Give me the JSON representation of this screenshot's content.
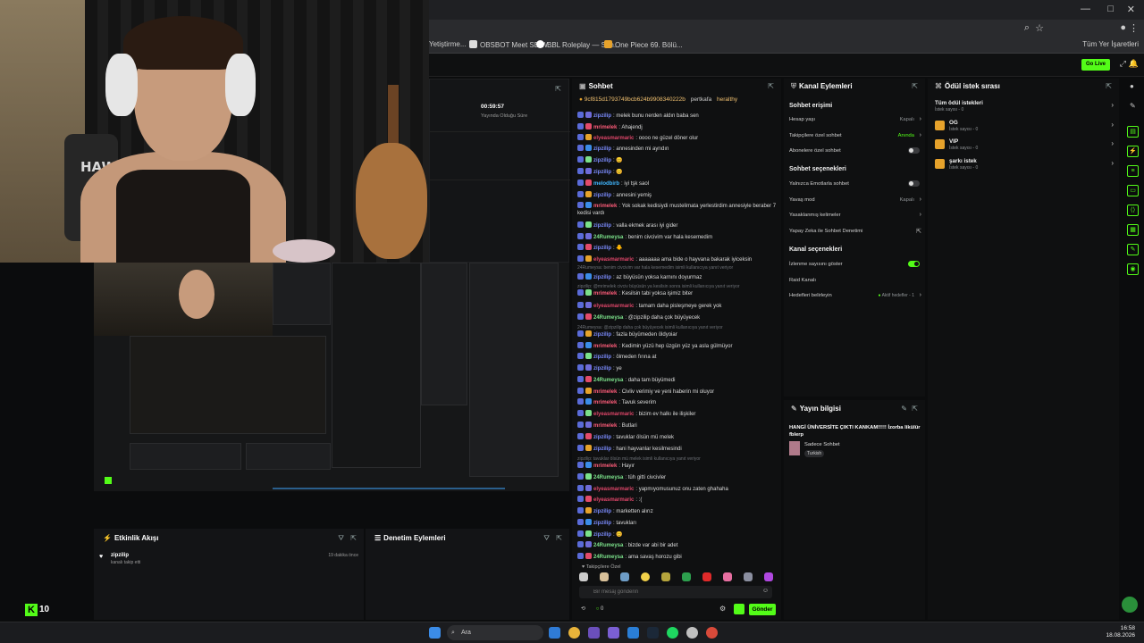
{
  "browser": {
    "bookmarks": [
      "Yetiştirme...",
      "OBSBOT Meet SE W...",
      "BBL Roleplay — San...",
      "One Piece 69. Bölü..."
    ],
    "all_bookmarks": "Tüm Yer İşaretleri"
  },
  "header": {
    "go_live": "Go Live"
  },
  "stream_stats": {
    "duration": "00:59:57",
    "duration_label": "Yayında Olduğu Süre"
  },
  "chat": {
    "title": "Sohbet",
    "pinned_user": "9cf815d1793749bcb624b9908340222b",
    "pinned_badge_users": [
      "pertkafa",
      "heralthy"
    ],
    "messages": [
      {
        "user": "zipzilip",
        "text": "melek bunu nerden aldın baba sen",
        "color": "#7c8cff"
      },
      {
        "user": "mrimelek",
        "text": "Ahajendj",
        "color": "#ff5c7a"
      },
      {
        "user": "elyeasmarmaric",
        "text": "oooo ne güzel döner olur",
        "color": "#e0466a"
      },
      {
        "user": "zipzilip",
        "text": "annesinden mi ayrıdın",
        "color": "#7c8cff"
      },
      {
        "user": "zipzilip",
        "text": "😊",
        "color": "#7c8cff"
      },
      {
        "user": "zipzilip",
        "text": "😊",
        "color": "#7c8cff"
      },
      {
        "user": "melodbirb",
        "text": "iyi tşk saol",
        "color": "#41b7ff"
      },
      {
        "user": "zipzilip",
        "text": "annesini yemiş",
        "color": "#7c8cff"
      },
      {
        "user": "mrimelek",
        "text": "Yok sokak kedisiydi mustelimata yerlestirdim annesiyle beraber 7 kedisi vardı",
        "color": "#ff5c7a"
      },
      {
        "user": "zipzilip",
        "text": "valla ekmek arası iyi gider",
        "color": "#7c8cff"
      },
      {
        "user": "24Rumeysa",
        "text": "benim civcivim var hala kesemedim",
        "color": "#7be08a"
      },
      {
        "user": "zipzilip",
        "text": "🐥",
        "color": "#7c8cff"
      },
      {
        "user": "elyeasmarmaric",
        "text": "aaaaaaa ama bide o hayvana bakarak iyiceksin",
        "color": "#e0466a"
      },
      {
        "user": "zipzilip",
        "text": "az büyüsün yoksa karnını doyurmaz",
        "color": "#7c8cff"
      },
      {
        "user": "mrimelek",
        "text": "Kesilsin tabi yoksa işimiz biter",
        "color": "#ff5c7a"
      },
      {
        "user": "elyeasmarmaric",
        "text": "tamam daha pisleşmeye gerek yok",
        "color": "#e0466a"
      },
      {
        "user": "24Rumeysa",
        "text": "@zipzilip daha çok büyüyecek",
        "color": "#7be08a"
      },
      {
        "user": "zipzilip",
        "text": "fazla büyümeden öldyoiar",
        "color": "#7c8cff"
      },
      {
        "user": "mrimelek",
        "text": "Kedimin yüzü hep üzgün yüz ya asla gülmüyor",
        "color": "#ff5c7a"
      },
      {
        "user": "zipzilip",
        "text": "ölmeden fırına at",
        "color": "#7c8cff"
      },
      {
        "user": "zipzilip",
        "text": "ye",
        "color": "#7c8cff"
      },
      {
        "user": "24Rumeysa",
        "text": "daha tam büyümedi",
        "color": "#7be08a"
      },
      {
        "user": "mrimelek",
        "text": "Civliv verimiy ve yeni haberin mi oluyor",
        "color": "#ff5c7a"
      },
      {
        "user": "mrimelek",
        "text": "Tavuk severim",
        "color": "#ff5c7a"
      },
      {
        "user": "elyeasmarmaric",
        "text": "bizim ev halkı ile ilişkiler",
        "color": "#e0466a"
      },
      {
        "user": "mrimelek",
        "text": "Butlari",
        "color": "#ff5c7a"
      },
      {
        "user": "zipzilip",
        "text": "tavuklar ölsün mü melek",
        "color": "#7c8cff"
      },
      {
        "user": "zipzilip",
        "text": "hani hayvanlar kesilmesindi",
        "color": "#7c8cff"
      },
      {
        "user": "mrimelek",
        "text": "Hayır",
        "color": "#ff5c7a"
      },
      {
        "user": "24Rumeysa",
        "text": "tüh gitti civcivler",
        "color": "#7be08a"
      },
      {
        "user": "elyeasmarmaric",
        "text": "yapmıyomusunuz onu zaten ghahaha",
        "color": "#e0466a"
      },
      {
        "user": "elyeasmarmaric",
        "text": ":(",
        "color": "#e0466a"
      },
      {
        "user": "zipzilip",
        "text": "marketten alırız",
        "color": "#7c8cff"
      },
      {
        "user": "zipzilip",
        "text": "tavukları",
        "color": "#7c8cff"
      },
      {
        "user": "zipzilip",
        "text": "😊",
        "color": "#7c8cff"
      },
      {
        "user": "24Rumeysa",
        "text": "bizde var abi bir adet",
        "color": "#7be08a"
      },
      {
        "user": "24Rumeysa",
        "text": "ama savaş horozu gibi",
        "color": "#7be08a"
      }
    ],
    "system_lines": [
      "24Rumeysa: benim civcivim var hala kesemedim isimli kullanıcıya yanıt veriyor",
      "zipzilip: @mrimelek civciv büyüsün ya kesilsin sonra isimli kullanıcıya yanıt veriyor",
      "24Rumeysa: @zipzilip daha çok büyüyecek isimli kullanıcıya yanıt veriyor",
      "zipzilip: tavuklar ölsün mü melek isimli kullanıcıya yanıt veriyor"
    ],
    "followers_only": "Takipçilere Özel",
    "input_placeholder": "Bir mesaj gönderin",
    "viewer_count": "0",
    "send_label": "Gönder"
  },
  "channel_actions": {
    "title": "Kanal Eylemleri",
    "chat_access": "Sohbet erişimi",
    "account_age": "Hesap yaşı",
    "account_age_value": "Kapalı",
    "followers_chat": "Takipçilere özel sohbet",
    "followers_chat_value": "Anında",
    "subscribers_chat": "Abonelere özel sohbet",
    "chat_options": "Sohbet seçenekleri",
    "emotes_only": "Yalnızca Emotlarla sohbet",
    "slow_mode": "Yavaş mod",
    "slow_mode_value": "Kapalı",
    "banned_words": "Yasaklanmış kelimeler",
    "ai_moderation": "Yapay Zeka ile Sohbet Denetimi",
    "channel_options": "Kanal seçenekleri",
    "show_viewers": "İzlenme sayısını göster",
    "raid": "Raid Kanalı",
    "set_goals": "Hedefleri belirleyin",
    "goals_value": "Aktif hedefler - 1"
  },
  "stream_info": {
    "title": "Yayın bilgisi",
    "stream_title": "HANGİ ÜNİVERSİTE ÇIKTI KANKAM!!!!! İzorba likülür fblerp",
    "category": "Sadece Sohbet",
    "language": "Turkish"
  },
  "rewards": {
    "title": "Ödül istek sırası",
    "items": [
      {
        "name": "Tüm ödül istekleri",
        "sub": "İstek sayısı - 0"
      },
      {
        "name": "OG",
        "sub": "İstek sayısı - 0"
      },
      {
        "name": "VIP",
        "sub": "İstek sayısı - 0"
      },
      {
        "name": "şarkı istek",
        "sub": "İstek sayısı - 0"
      }
    ]
  },
  "activity": {
    "title": "Etkinlik Akışı",
    "event_user": "zipzilip",
    "event_text": "kanalı takip etti",
    "event_time": "19 dakika önce"
  },
  "moderation": {
    "title": "Denetim Eylemleri"
  },
  "kick_count": "10",
  "taskbar": {
    "search": "Ara",
    "time": "16:58",
    "date": "18.08.2026"
  },
  "colors": {
    "accent": "#53fc18",
    "panel": "#0f1011"
  }
}
